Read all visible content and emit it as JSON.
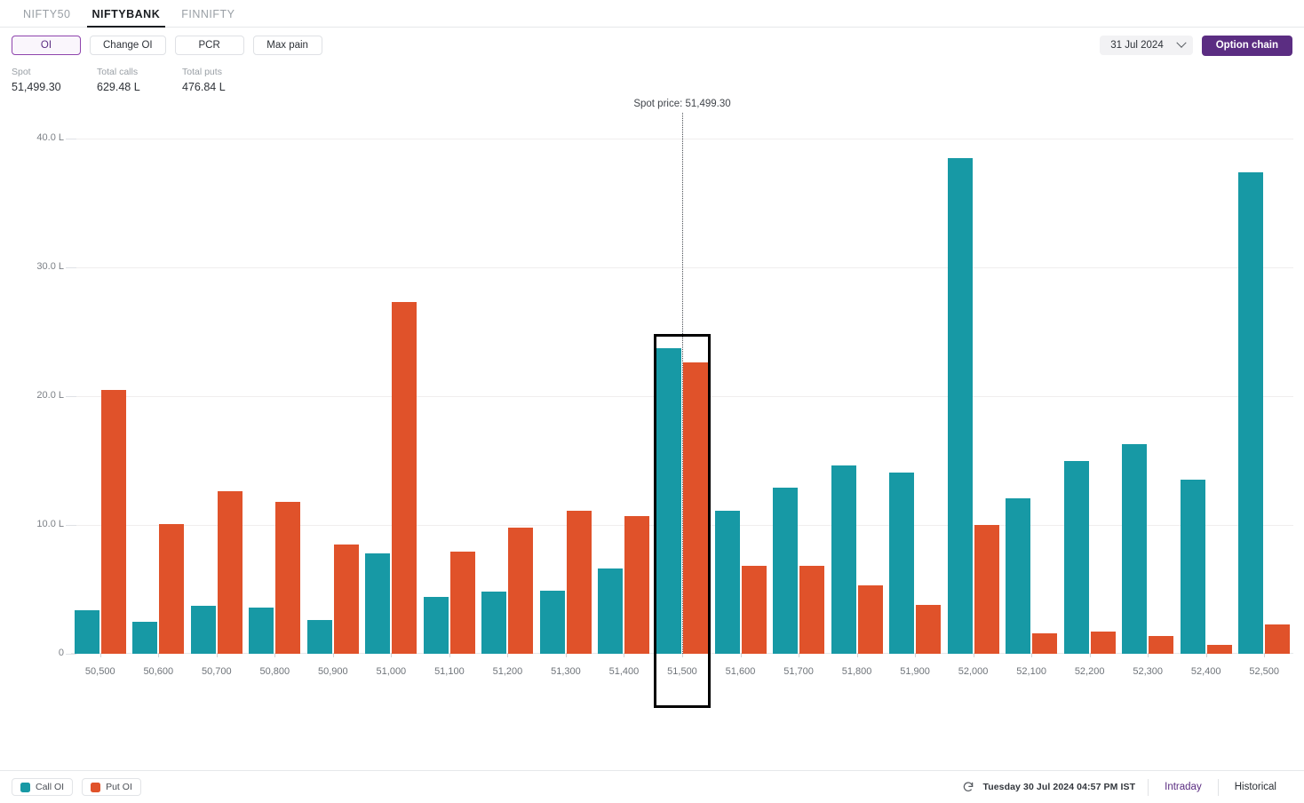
{
  "header": {
    "tabs": [
      {
        "label": "NIFTY50",
        "active": false
      },
      {
        "label": "NIFTYBANK",
        "active": true
      },
      {
        "label": "FINNIFTY",
        "active": false
      }
    ]
  },
  "toolbar": {
    "segments": [
      {
        "label": "OI",
        "active": true
      },
      {
        "label": "Change OI",
        "active": false
      },
      {
        "label": "PCR",
        "active": false
      },
      {
        "label": "Max pain",
        "active": false
      }
    ],
    "expiry_label": "31 Jul 2024",
    "expiry_icon": "chevron-down-icon",
    "option_chain_label": "Option chain",
    "accent_color": "#5b2d82"
  },
  "stats": [
    {
      "label": "Spot",
      "value": "51,499.30"
    },
    {
      "label": "Total calls",
      "value": "629.48 L"
    },
    {
      "label": "Total puts",
      "value": "476.84 L"
    }
  ],
  "footer": {
    "legend": [
      {
        "label": "Call OI",
        "color": "#1799a5"
      },
      {
        "label": "Put OI",
        "color": "#e0522a"
      }
    ],
    "refresh_icon": "refresh-icon",
    "timestamp": "Tuesday 30 Jul 2024 04:57 PM IST",
    "links": [
      {
        "label": "Intraday",
        "active": true
      },
      {
        "label": "Historical",
        "active": false
      }
    ]
  },
  "chart_data": {
    "type": "bar",
    "title": "",
    "xlabel": "",
    "ylabel": "",
    "ylim": [
      0,
      42
    ],
    "yticks": [
      0,
      10,
      20,
      30,
      40
    ],
    "ytick_labels": [
      "0",
      "10.0 L",
      "20.0 L",
      "30.0 L",
      "40.0 L"
    ],
    "grid": true,
    "legend_position": "bottom-left",
    "categories": [
      "50,500",
      "50,600",
      "50,700",
      "50,800",
      "50,900",
      "51,000",
      "51,100",
      "51,200",
      "51,300",
      "51,400",
      "51,500",
      "51,600",
      "51,700",
      "51,800",
      "51,900",
      "52,000",
      "52,100",
      "52,200",
      "52,300",
      "52,400",
      "52,500"
    ],
    "series": [
      {
        "name": "Call OI",
        "color": "#1799a5",
        "values": [
          3.4,
          2.5,
          3.7,
          3.6,
          2.6,
          7.8,
          4.4,
          4.8,
          4.9,
          6.6,
          23.7,
          11.1,
          12.9,
          14.6,
          14.1,
          38.5,
          12.1,
          15.0,
          16.3,
          13.5,
          37.4
        ]
      },
      {
        "name": "Put OI",
        "color": "#e0522a",
        "values": [
          20.5,
          10.1,
          12.6,
          11.8,
          8.5,
          27.3,
          7.9,
          9.8,
          11.1,
          10.7,
          22.6,
          6.8,
          6.8,
          5.3,
          3.8,
          10.0,
          1.6,
          1.7,
          1.4,
          0.7,
          2.3
        ]
      }
    ],
    "annotations": [
      {
        "type": "vline",
        "label": "Spot price: 51,499.30",
        "x_value": 51499.3,
        "style": "dotted"
      },
      {
        "type": "highlight-box",
        "category": "51,500"
      }
    ]
  }
}
